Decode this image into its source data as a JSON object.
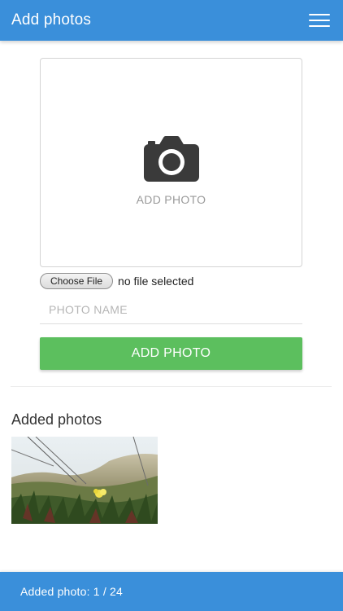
{
  "header": {
    "title": "Add photos",
    "menu_icon": "hamburger-menu-icon"
  },
  "upload": {
    "icon": "camera-icon",
    "label": "ADD PHOTO"
  },
  "file_input": {
    "button_label": "Choose File",
    "status": "no file selected"
  },
  "photo_name": {
    "placeholder": "PHOTO NAME",
    "value": ""
  },
  "add_button": {
    "label": "ADD PHOTO"
  },
  "gallery": {
    "title": "Added photos",
    "photos": [
      {
        "description": "grass and yellow flower on dune"
      }
    ]
  },
  "footer": {
    "status": "Added photo: 1 / 24"
  },
  "colors": {
    "header_bg": "#3a8fda",
    "button_green": "#5cbf5e",
    "footer_bg": "#3a8fda"
  }
}
